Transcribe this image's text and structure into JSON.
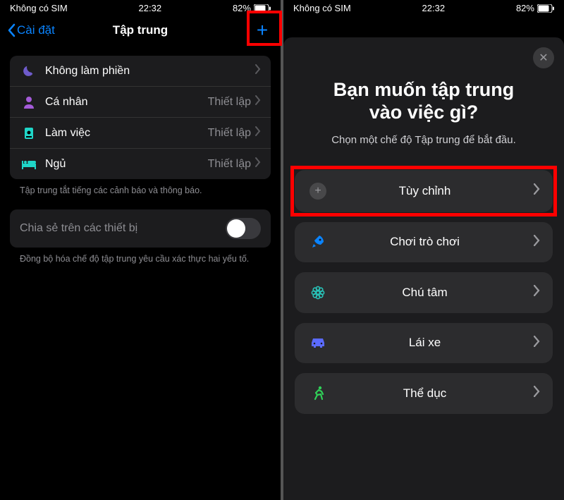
{
  "status": {
    "carrier": "Không có SIM",
    "time": "22:32",
    "battery": "82%"
  },
  "left_screen": {
    "back_label": "Cài đặt",
    "title": "Tập trung",
    "modes": [
      {
        "icon": "moon-icon",
        "label": "Không làm phiền",
        "detail": "",
        "color": "#6e5bcb"
      },
      {
        "icon": "person-icon",
        "label": "Cá nhân",
        "detail": "Thiết lập",
        "color": "#a45bd8"
      },
      {
        "icon": "badge-icon",
        "label": "Làm việc",
        "detail": "Thiết lập",
        "color": "#1fd6c8"
      },
      {
        "icon": "bed-icon",
        "label": "Ngủ",
        "detail": "Thiết lập",
        "color": "#1fd6c8"
      }
    ],
    "group_footer": "Tập trung tắt tiếng các cảnh báo và thông báo.",
    "share_label": "Chia sẻ trên các thiết bị",
    "share_footer": "Đồng bộ hóa chế độ tập trung yêu cầu xác thực hai yếu tố."
  },
  "right_screen": {
    "heading_line1": "Bạn muốn tập trung",
    "heading_line2": "vào việc gì?",
    "subtitle": "Chọn một chế độ Tập trung để bắt đầu.",
    "options": [
      {
        "icon": "plus-circle-icon",
        "label": "Tùy chỉnh",
        "color": "#8e8e93"
      },
      {
        "icon": "rocket-icon",
        "label": "Chơi trò chơi",
        "color": "#0a84ff"
      },
      {
        "icon": "flower-icon",
        "label": "Chú tâm",
        "color": "#28c3b8"
      },
      {
        "icon": "car-icon",
        "label": "Lái xe",
        "color": "#5b6bff"
      },
      {
        "icon": "runner-icon",
        "label": "Thể dục",
        "color": "#30d158"
      }
    ]
  }
}
